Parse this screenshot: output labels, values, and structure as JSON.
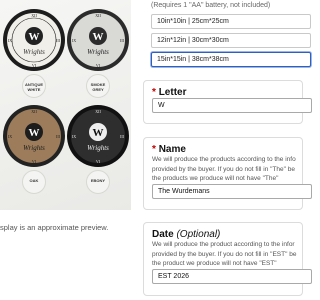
{
  "preview": {
    "clocks": [
      {
        "name": "Antique White",
        "letter": "W",
        "script": "Wrights"
      },
      {
        "name": "Smoke Grey",
        "letter": "W",
        "script": "Wrights"
      },
      {
        "name": "Oak",
        "letter": "W",
        "script": "Wrights"
      },
      {
        "name": "Ebony",
        "letter": "W",
        "script": "Wrights"
      }
    ],
    "tags": [
      {
        "line1": "ANTIQUE",
        "line2": "WHITE"
      },
      {
        "line1": "SMOKE",
        "line2": "GREY"
      },
      {
        "line1": "OAK",
        "line2": ""
      },
      {
        "line1": "EBONY",
        "line2": ""
      }
    ],
    "caption": "splay is an approximate preview."
  },
  "size": {
    "note": "(Requires 1 \"AA\" battery, not included)",
    "options": [
      {
        "label": "10in*10in | 25cm*25cm",
        "selected": false
      },
      {
        "label": "12in*12in | 30cm*30cm",
        "selected": false
      },
      {
        "label": "15in*15in | 38cm*38cm",
        "selected": true
      }
    ]
  },
  "letter": {
    "title": "Letter",
    "required": "*",
    "value": "W"
  },
  "name": {
    "title": "Name",
    "required": "*",
    "help1": "We will produce the products according to the info",
    "help2": "provided by the buyer. If you do not fill in \"The\" be",
    "help3": "the products we produce will not have \"The\"",
    "value": "The Wurdemans"
  },
  "date": {
    "title": "Date",
    "optional": "(Optional)",
    "help1": "We will produce the product according to the infor",
    "help2": "provided by the buyer. If you do not fill in \"EST\" be",
    "help3": "the product we produce will not have \"EST\"",
    "value": "EST 2026"
  },
  "colors": {
    "selected_border": "#2f5fbf",
    "required": "#c40000"
  }
}
